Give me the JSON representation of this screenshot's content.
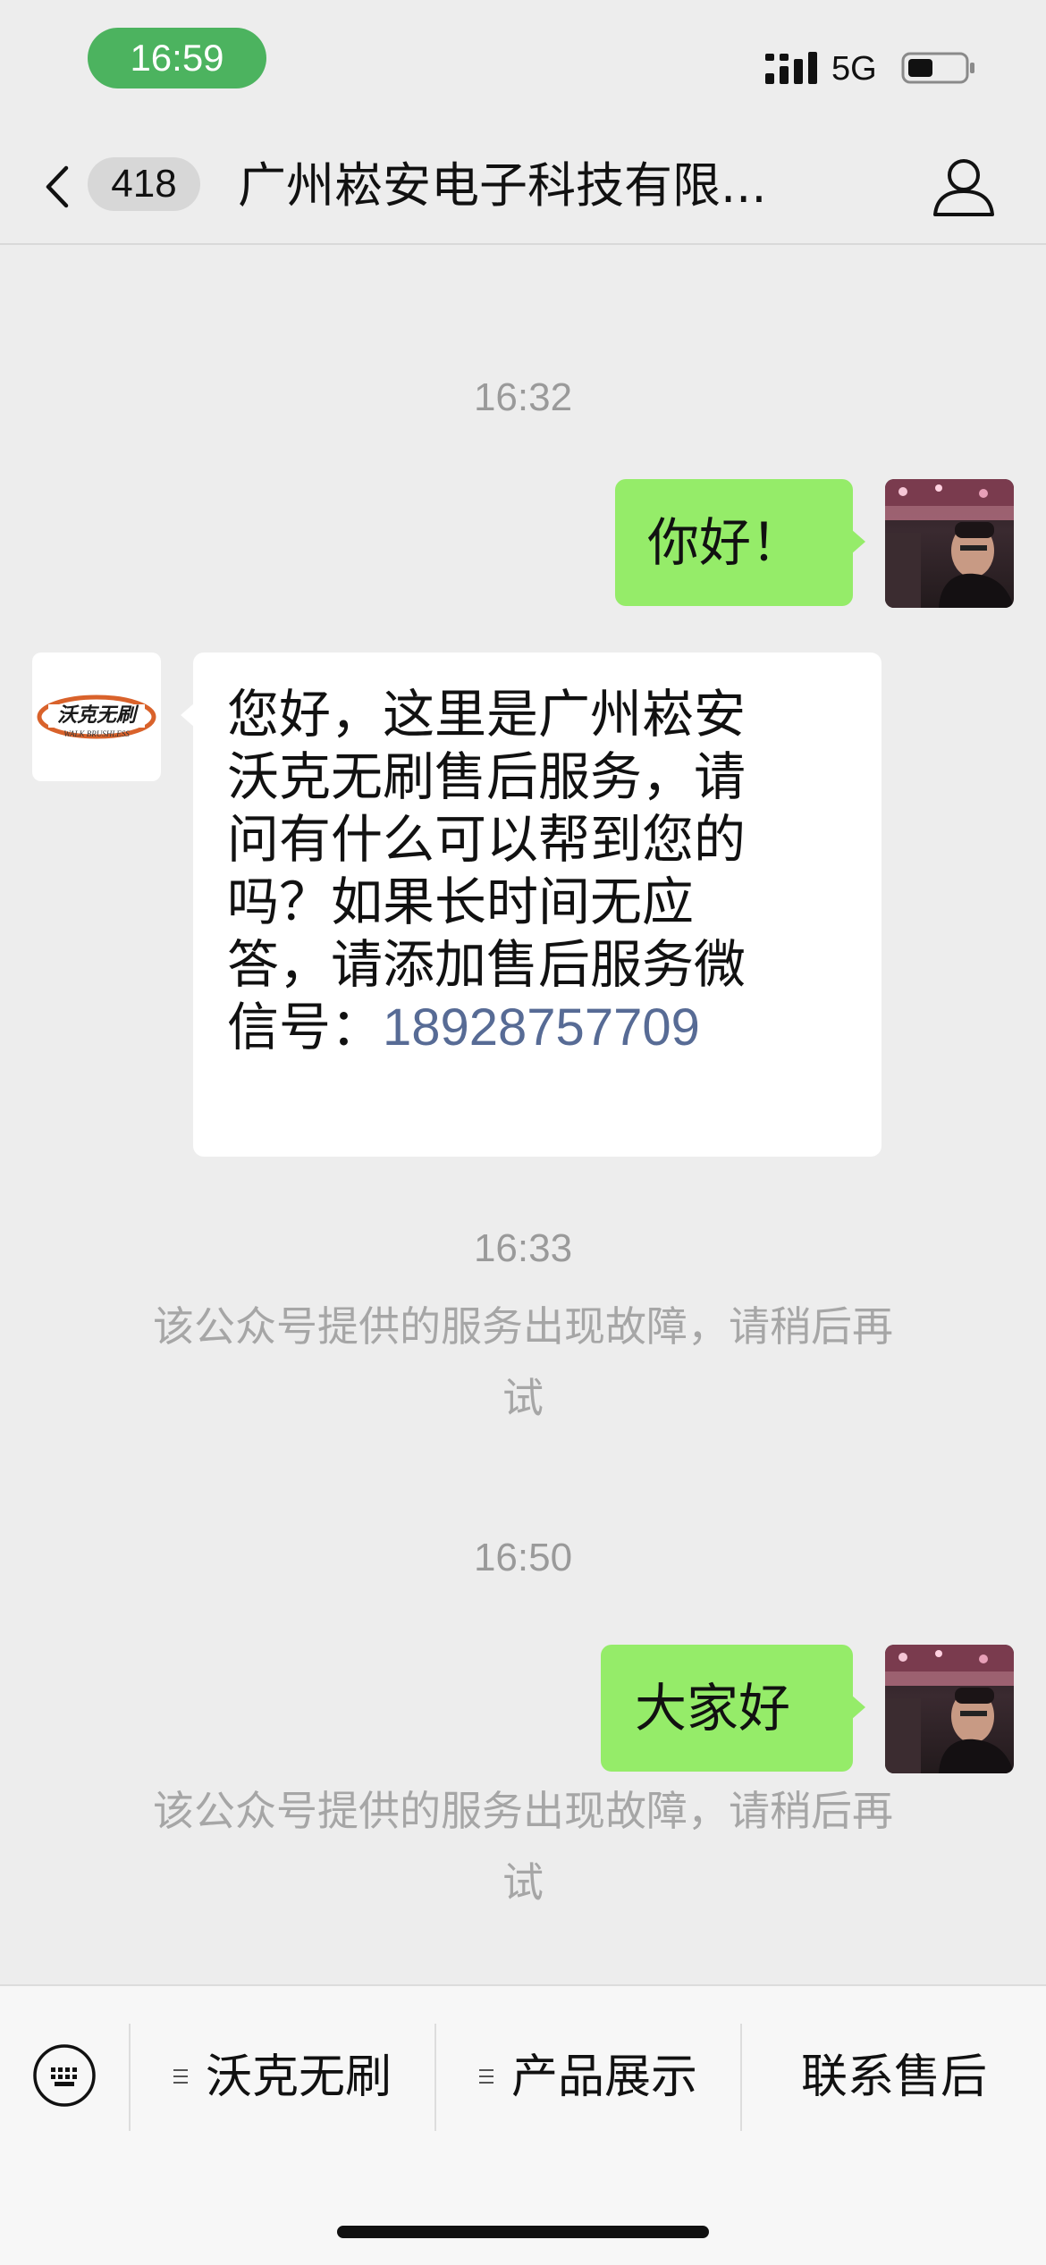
{
  "status_bar": {
    "time": "16:59",
    "network": "5G",
    "battery_level": 0.45,
    "colors": {
      "time_pill": "#4cb35f"
    }
  },
  "header": {
    "back_icon": "chevron-left-icon",
    "unread_count": "418",
    "title": "广州崧安电子科技有限...",
    "profile_icon": "person-icon"
  },
  "chat": {
    "messages": [
      {
        "kind": "timestamp",
        "text": "16:32"
      },
      {
        "kind": "outgoing",
        "sender": "me",
        "text": "你好！"
      },
      {
        "kind": "incoming",
        "sender": "沃克无刷",
        "avatar_logo": {
          "brand_cn": "沃克无刷",
          "brand_en": "WALK BRUSHLESS"
        },
        "lines": [
          "您好，这里是广州崧安",
          "沃克无刷售后服务，请",
          "问有什么可以帮到您的",
          "吗？如果长时间无应",
          "答，请添加售后服务微"
        ],
        "last_line_prefix": "信号：",
        "phone": "18928757709"
      },
      {
        "kind": "timestamp",
        "text": "16:33"
      },
      {
        "kind": "system",
        "lines": [
          "该公众号提供的服务出现故障，请稍后再",
          "试"
        ]
      },
      {
        "kind": "timestamp",
        "text": "16:50"
      },
      {
        "kind": "outgoing",
        "sender": "me",
        "text": "大家好"
      },
      {
        "kind": "system",
        "lines": [
          "该公众号提供的服务出现故障，请稍后再",
          "试"
        ]
      }
    ],
    "colors": {
      "background": "#ededed",
      "outgoing_bubble": "#95ec69",
      "incoming_bubble": "#ffffff",
      "link": "#576b95",
      "timestamp": "#9a9a9a"
    }
  },
  "bottom_menu": {
    "keyboard_icon": "keyboard-icon",
    "items": [
      {
        "label": "沃克无刷",
        "has_submenu": true
      },
      {
        "label": "产品展示",
        "has_submenu": true
      },
      {
        "label": "联系售后",
        "has_submenu": false
      }
    ]
  }
}
